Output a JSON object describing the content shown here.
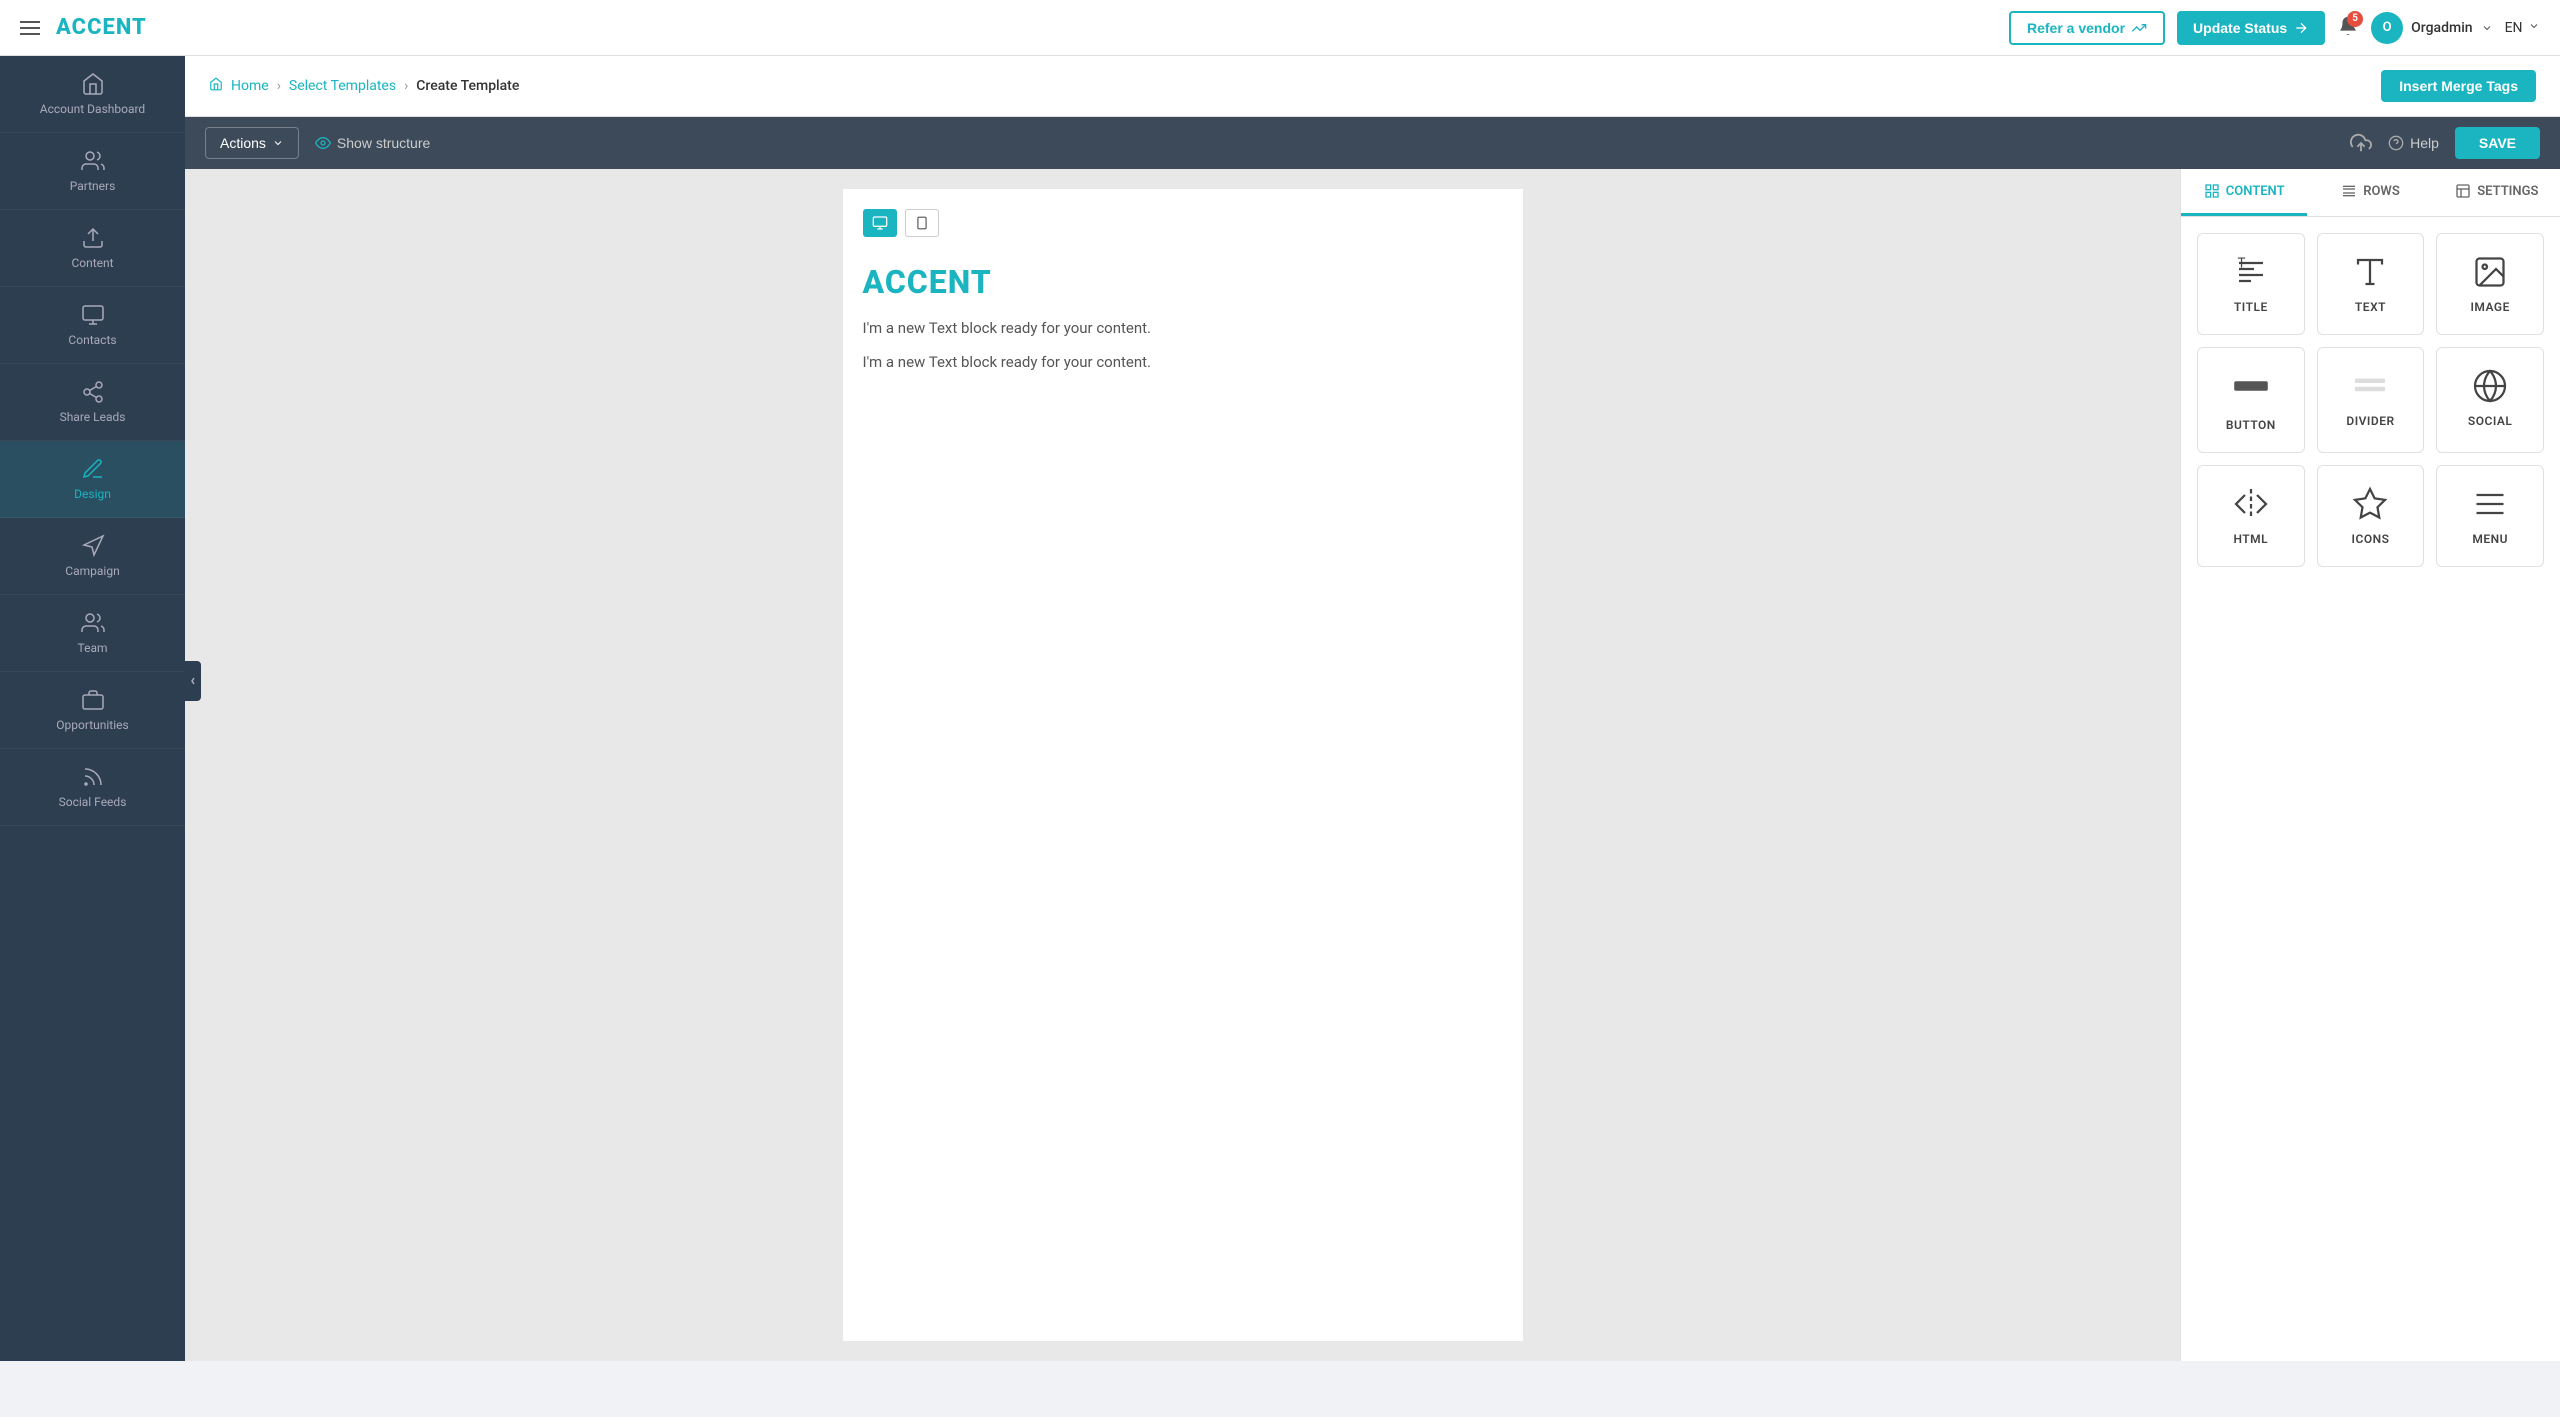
{
  "app": {
    "logo": "ACCENT",
    "hamburger_label": "menu"
  },
  "topnav": {
    "refer_vendor": "Refer a vendor",
    "update_status": "Update Status",
    "notification_count": "5",
    "user_name": "Orgadmin",
    "lang": "EN"
  },
  "sidebar": {
    "items": [
      {
        "id": "account-dashboard",
        "label": "Account Dashboard",
        "icon": "home"
      },
      {
        "id": "partners",
        "label": "Partners",
        "icon": "partners"
      },
      {
        "id": "content",
        "label": "Content",
        "icon": "content"
      },
      {
        "id": "contacts",
        "label": "Contacts",
        "icon": "contacts"
      },
      {
        "id": "share-leads",
        "label": "Share Leads",
        "icon": "share"
      },
      {
        "id": "design",
        "label": "Design",
        "icon": "design",
        "active": true
      },
      {
        "id": "campaign",
        "label": "Campaign",
        "icon": "campaign"
      },
      {
        "id": "team",
        "label": "Team",
        "icon": "team"
      },
      {
        "id": "opportunities",
        "label": "Opportunities",
        "icon": "opportunities"
      },
      {
        "id": "social-feeds",
        "label": "Social Feeds",
        "icon": "social"
      }
    ]
  },
  "breadcrumb": {
    "home": "Home",
    "select_templates": "Select Templates",
    "current": "Create Template"
  },
  "toolbar": {
    "actions_label": "Actions",
    "show_structure": "Show structure",
    "help_label": "Help",
    "save_label": "SAVE"
  },
  "canvas": {
    "logo_text": "ACCENT",
    "text_block_1": "I'm a new Text block ready for your content.",
    "text_block_2": "I'm a new Text block ready for your content."
  },
  "right_panel": {
    "tabs": [
      {
        "id": "content",
        "label": "CONTENT",
        "active": true
      },
      {
        "id": "rows",
        "label": "ROWS"
      },
      {
        "id": "settings",
        "label": "SETTINGS"
      }
    ],
    "content_items": [
      {
        "id": "title",
        "label": "TITLE"
      },
      {
        "id": "text",
        "label": "TEXT"
      },
      {
        "id": "image",
        "label": "IMAGE"
      },
      {
        "id": "button",
        "label": "BUTTON"
      },
      {
        "id": "divider",
        "label": "DIVIDER"
      },
      {
        "id": "social",
        "label": "SOCIAL"
      },
      {
        "id": "html",
        "label": "HTML"
      },
      {
        "id": "icons",
        "label": "ICONS"
      },
      {
        "id": "menu",
        "label": "MENU"
      }
    ]
  }
}
